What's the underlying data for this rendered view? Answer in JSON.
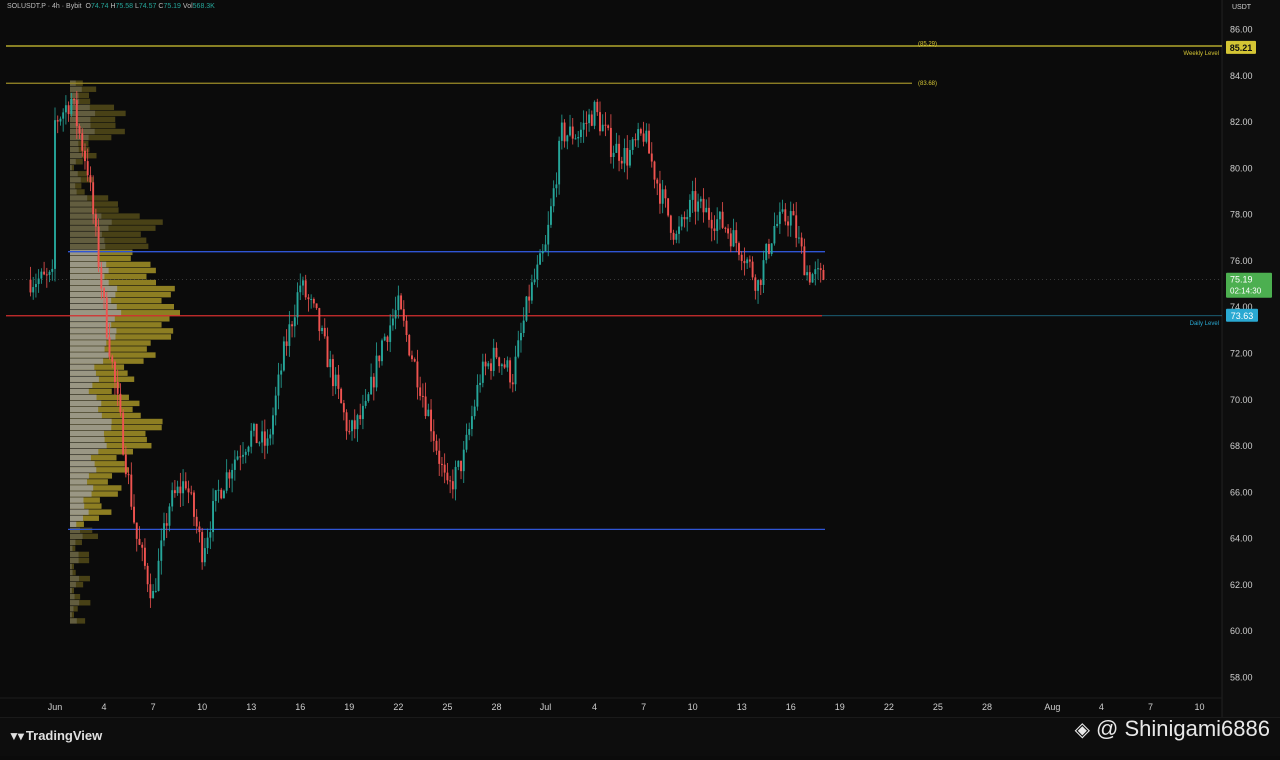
{
  "header": {
    "symbol": "SOLUSDT.P",
    "timeframe": "4h",
    "exchange": "Bybit",
    "open_label": "O",
    "open": "74.74",
    "high_label": "H",
    "high": "75.58",
    "low_label": "L",
    "low": "74.57",
    "close_label": "C",
    "close": "75.19",
    "vol_label": "Vol",
    "vol": "568.3K"
  },
  "price_axis": {
    "currency": "USDT",
    "ticks": [
      "86.00",
      "84.00",
      "82.00",
      "80.00",
      "78.00",
      "76.00",
      "74.00",
      "72.00",
      "70.00",
      "68.00",
      "66.00",
      "64.00",
      "62.00",
      "60.00",
      "58.00"
    ],
    "current_price": "75.19",
    "countdown": "02:14:30",
    "weekly_level_price": "85.21",
    "daily_level_price": "73.63"
  },
  "time_axis": {
    "labels": [
      "Jun",
      "4",
      "7",
      "10",
      "13",
      "16",
      "19",
      "22",
      "25",
      "28",
      "Jul",
      "4",
      "7",
      "10",
      "13",
      "16",
      "19",
      "22",
      "25",
      "28",
      "Aug",
      "4",
      "7",
      "10"
    ]
  },
  "levels": {
    "weekly_level_label": "Weekly Level",
    "daily_level_label": "Daily Level",
    "top_line_tag": "(85.29)",
    "upper_line_tag": "(83.68)"
  },
  "brand": {
    "name": "TradingView",
    "logo_icon": "tradingview-logo-icon"
  },
  "watermark": {
    "text": "@ Shinigami6886",
    "icon": "binance-logo-icon"
  },
  "colors": {
    "up": "#26a69a",
    "down": "#ef5350",
    "weekly_level": "#d4c534",
    "daily_level": "#2aa9d2",
    "range_line": "#2f55d4",
    "poc_line": "#d32f2f",
    "volume_profile_yellow": "#b9a62b",
    "volume_profile_grey": "#9e9e9e",
    "current_price_badge": "#4caf50"
  },
  "chart_data": {
    "type": "candlestick",
    "title": "SOLUSDT.P · 4h · Bybit",
    "ylim": [
      57.5,
      86.5
    ],
    "x_start": "Jun 1",
    "x_axis_end": "Aug 11",
    "horizontal_lines": [
      {
        "price": 85.29,
        "label": "(85.29)",
        "color": "#d4c534"
      },
      {
        "price": 85.21,
        "label": "Weekly Level",
        "color": "#d4c534"
      },
      {
        "price": 83.68,
        "label": "(83.68)",
        "color": "#9c8c28"
      },
      {
        "price": 76.4,
        "label": "",
        "color": "#2f55d4"
      },
      {
        "price": 73.63,
        "label": "Daily Level",
        "color": "#d32f2f"
      },
      {
        "price": 64.4,
        "label": "",
        "color": "#2f55d4"
      }
    ],
    "close_path": [
      [
        "Jun 1",
        82.0
      ],
      [
        "Jun 2",
        83.0
      ],
      [
        "Jun 3",
        80.0
      ],
      [
        "Jun 4",
        74.0
      ],
      [
        "Jun 5",
        69.0
      ],
      [
        "Jun 6",
        64.0
      ],
      [
        "Jun 7",
        61.5
      ],
      [
        "Jun 8",
        65.5
      ],
      [
        "Jun 9",
        66.5
      ],
      [
        "Jun 10",
        63.5
      ],
      [
        "Jun 11",
        66.0
      ],
      [
        "Jun 12",
        67.5
      ],
      [
        "Jun 13",
        68.5
      ],
      [
        "Jun 14",
        68.0
      ],
      [
        "Jun 15",
        72.0
      ],
      [
        "Jun 16",
        75.0
      ],
      [
        "Jun 17",
        73.5
      ],
      [
        "Jun 18",
        71.0
      ],
      [
        "Jun 19",
        68.5
      ],
      [
        "Jun 20",
        69.5
      ],
      [
        "Jun 21",
        72.5
      ],
      [
        "Jun 22",
        74.0
      ],
      [
        "Jun 23",
        71.5
      ],
      [
        "Jun 24",
        69.0
      ],
      [
        "Jun 25",
        66.0
      ],
      [
        "Jun 26",
        67.5
      ],
      [
        "Jun 27",
        71.0
      ],
      [
        "Jun 28",
        72.0
      ],
      [
        "Jun 29",
        71.0
      ],
      [
        "Jun 30",
        74.5
      ],
      [
        "Jul 1",
        76.5
      ],
      [
        "Jul 2",
        81.5
      ],
      [
        "Jul 3",
        81.5
      ],
      [
        "Jul 4",
        82.5
      ],
      [
        "Jul 5",
        81.0
      ],
      [
        "Jul 6",
        80.5
      ],
      [
        "Jul 7",
        81.5
      ],
      [
        "Jul 8",
        79.0
      ],
      [
        "Jul 9",
        77.0
      ],
      [
        "Jul 10",
        78.5
      ],
      [
        "Jul 11",
        78.0
      ],
      [
        "Jul 12",
        77.5
      ],
      [
        "Jul 13",
        76.5
      ],
      [
        "Jul 14",
        75.0
      ],
      [
        "Jul 15",
        77.5
      ],
      [
        "Jul 16",
        78.0
      ],
      [
        "Jul 17",
        75.5
      ],
      [
        "Jul 18",
        75.19
      ]
    ]
  }
}
